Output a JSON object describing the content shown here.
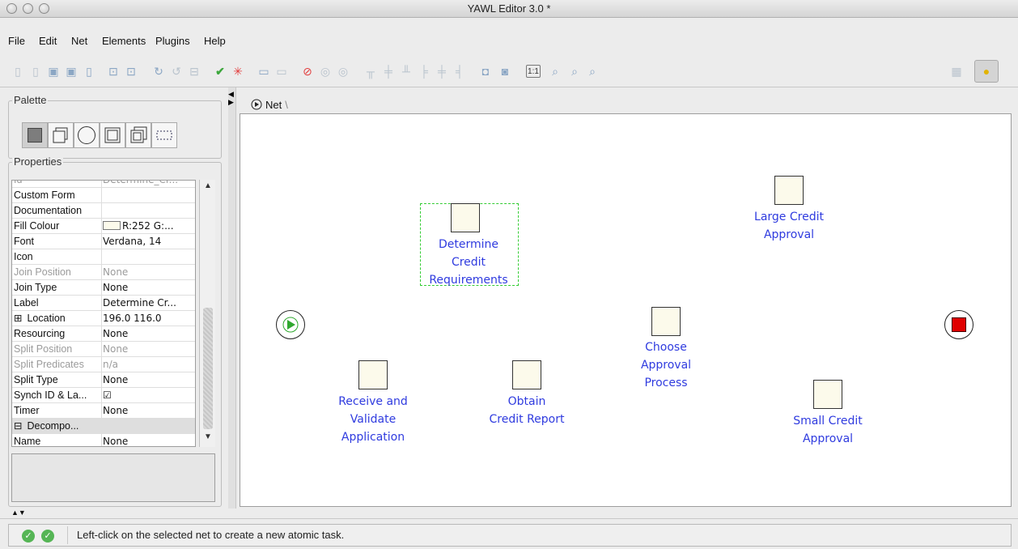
{
  "window": {
    "title": "YAWL Editor 3.0 *"
  },
  "menu": [
    "File",
    "Edit",
    "Net",
    "Elements",
    "Plugins",
    "Help"
  ],
  "toolbar": {
    "icons": [
      "new-specification-icon",
      "open-specification-icon",
      "save-icon",
      "save-as-icon",
      "close-specification-icon",
      "import-icon",
      "export-icon",
      "undo-icon",
      "redo-icon",
      "delete-icon",
      "validate-icon",
      "analyse-icon",
      "add-net-icon",
      "remove-net-icon",
      "cancellation-set-icon",
      "data-variables-icon",
      "decompositions-icon",
      "align-top-icon",
      "align-middle-icon",
      "align-bottom-icon",
      "align-left-icon",
      "align-center-icon",
      "align-right-icon",
      "increase-size-icon",
      "decrease-size-icon",
      "actual-size-icon",
      "zoom-out-icon",
      "zoom-in-icon",
      "zoom-fit-icon",
      "grid-icon",
      "notes-icon"
    ],
    "accent": "#e1b300"
  },
  "palette": {
    "title": "Palette",
    "tools": [
      "atomic-task-tool",
      "multiple-atomic-task-tool",
      "condition-tool",
      "composite-task-tool",
      "multiple-composite-task-tool",
      "marquee-selection-tool"
    ]
  },
  "properties": {
    "title": "Properties",
    "truncated_top": {
      "key": "Id",
      "value": "Determine_Cr..."
    },
    "rows": [
      {
        "key": "Custom Form",
        "value": "",
        "dim": false
      },
      {
        "key": "Documentation",
        "value": "",
        "dim": false
      },
      {
        "key": "Fill Colour",
        "value": "R:252 G:...",
        "dim": false,
        "swatch": "#fcfaeb"
      },
      {
        "key": "Font",
        "value": "Verdana, 14",
        "dim": false
      },
      {
        "key": "Icon",
        "value": "",
        "dim": false
      },
      {
        "key": "Join Position",
        "value": "None",
        "dim": true
      },
      {
        "key": "Join Type",
        "value": "None",
        "dim": false
      },
      {
        "key": "Label",
        "value": "Determine Cr...",
        "dim": false
      },
      {
        "key": "Location",
        "value": "196.0 116.0",
        "dim": false,
        "expander": "⊞"
      },
      {
        "key": "Resourcing",
        "value": "None",
        "dim": false
      },
      {
        "key": "Split Position",
        "value": "None",
        "dim": true
      },
      {
        "key": "Split Predicates",
        "value": "n/a",
        "dim": true
      },
      {
        "key": "Split Type",
        "value": "None",
        "dim": false
      },
      {
        "key": "Synch ID & La...",
        "value": "☑",
        "dim": false
      },
      {
        "key": "Timer",
        "value": "None",
        "dim": false
      },
      {
        "key": "Decompo...",
        "value": "",
        "dim": false,
        "expander": "⊟",
        "group": true
      },
      {
        "key": "Name",
        "value": "None",
        "dim": false
      }
    ]
  },
  "net_tab": {
    "label": "Net"
  },
  "net": {
    "tasks": [
      {
        "id": "determine",
        "label": [
          "Determine",
          "Credit",
          "Requirements"
        ],
        "selected": true
      },
      {
        "id": "large",
        "label": [
          "Large Credit",
          "Approval"
        ]
      },
      {
        "id": "choose",
        "label": [
          "Choose",
          "Approval",
          "Process"
        ]
      },
      {
        "id": "receive",
        "label": [
          "Receive and",
          "Validate",
          "Application"
        ]
      },
      {
        "id": "obtain",
        "label": [
          "Obtain",
          "Credit Report"
        ]
      },
      {
        "id": "small",
        "label": [
          "Small Credit",
          "Approval"
        ]
      }
    ],
    "task_fill": "#fcfaeb",
    "label_color": "#2f3bdf",
    "input_condition_color": "#2ea82e",
    "output_condition_color": "#e00000"
  },
  "status": {
    "message": "Left-click on the selected net to create a new atomic task."
  }
}
